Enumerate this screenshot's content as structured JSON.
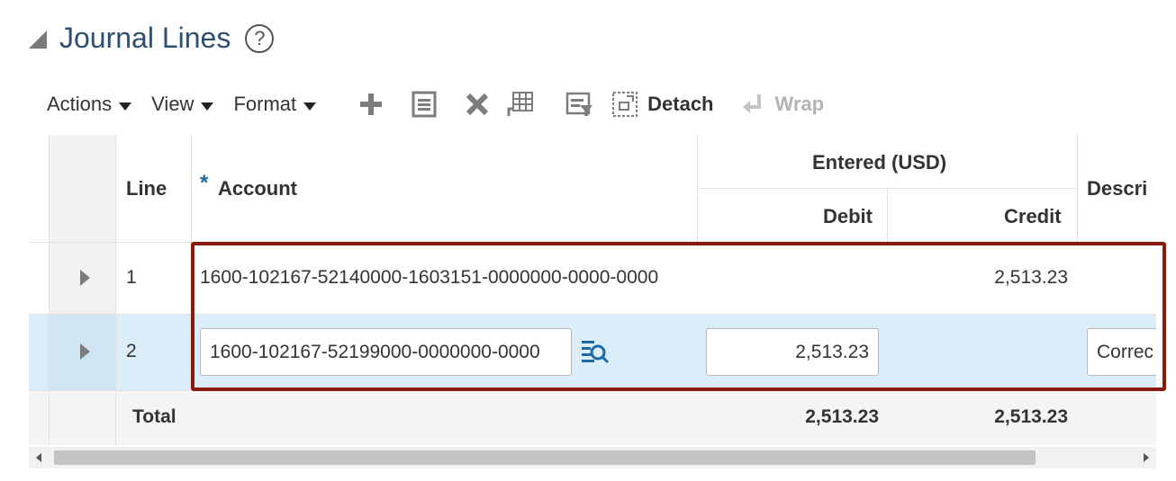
{
  "section": {
    "title": "Journal Lines",
    "help_glyph": "?"
  },
  "toolbar": {
    "actions_label": "Actions",
    "view_label": "View",
    "format_label": "Format",
    "icons": [
      "plus-icon",
      "duplicate-icon",
      "delete-icon",
      "split-icon",
      "query-by-example-icon"
    ],
    "detach_label": "Detach",
    "wrap_label": "Wrap"
  },
  "table": {
    "headers": {
      "line": "Line",
      "required_marker": "*",
      "account": "Account",
      "entered_group": "Entered (USD)",
      "debit": "Debit",
      "credit": "Credit",
      "description": "Descri"
    },
    "rows": [
      {
        "line": "1",
        "account": "1600-102167-52140000-1603151-0000000-0000-0000",
        "debit": "",
        "credit": "2,513.23",
        "description": ""
      },
      {
        "line": "2",
        "account": "1600-102167-52199000-0000000-0000",
        "debit": "2,513.23",
        "credit": "",
        "description": "Correc"
      }
    ],
    "total": {
      "label": "Total",
      "debit": "2,513.23",
      "credit": "2,513.23"
    }
  },
  "colors": {
    "title": "#2f4f6f",
    "selected_row": "#dbedf9",
    "highlight_border": "#8b1a0d",
    "search_icon": "#1a6aa8",
    "required_marker": "#1a6aa8"
  }
}
